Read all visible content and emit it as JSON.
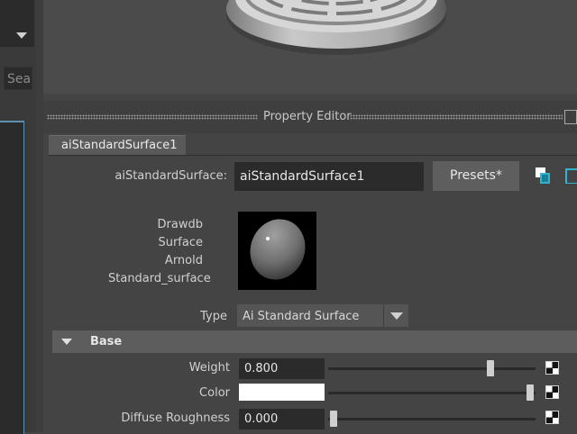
{
  "left_panel": {
    "search_placeholder": "Sea"
  },
  "property_editor": {
    "title": "Property Editor",
    "tab_label": "aiStandardSurface1",
    "node_type_label": "aiStandardSurface:",
    "node_name_value": "aiStandardSurface1",
    "presets_label": "Presets*",
    "swatch_labels": [
      "Drawdb",
      "Surface",
      "Arnold",
      "Standard_surface"
    ],
    "type_label": "Type",
    "type_value": "Ai Standard Surface",
    "section_title": "Base",
    "attributes": [
      {
        "label": "Weight",
        "value": "0.800",
        "slider": 0.8
      },
      {
        "label": "Color",
        "value": "",
        "color": "#ffffff",
        "slider": 1.0
      },
      {
        "label": "Diffuse Roughness",
        "value": "0.000",
        "slider": 0.0
      }
    ]
  },
  "icons": [
    "dropdown-arrow-icon",
    "float-window-icon",
    "copy-tab-icon",
    "show-hide-icon",
    "map-button-icon",
    "collapse-arrow-icon"
  ]
}
